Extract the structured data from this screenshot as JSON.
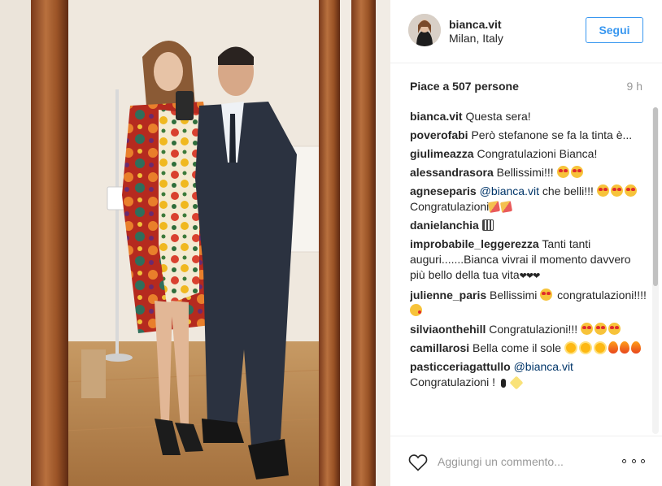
{
  "header": {
    "username": "bianca.vit",
    "location": "Milan, Italy",
    "follow_label": "Segui"
  },
  "likes": {
    "text": "Piace a 507 persone",
    "time": "9 h"
  },
  "comments": [
    {
      "user": "bianca.vit",
      "text": "Questa sera!"
    },
    {
      "user": "poverofabi",
      "text": "Però stefanone se fa la tinta è..."
    },
    {
      "user": "giulimeazza",
      "text": "Congratulazioni Bianca!"
    },
    {
      "user": "alessandrasora",
      "text": "Bellissimi!!!",
      "emoji": [
        "heart-eyes",
        "heart-eyes"
      ]
    },
    {
      "user": "agneseparis",
      "mention": "@bianca.vit",
      "text": "che belli!!!",
      "emoji": [
        "heart-eyes",
        "heart-eyes",
        "heart-eyes"
      ],
      "text2": "Congratulazioni",
      "emoji2": [
        "party",
        "party"
      ]
    },
    {
      "user": "danielanchia",
      "emoji": [
        "grid"
      ]
    },
    {
      "user": "improbabile_leggerezza",
      "text": "Tanti tanti auguri.......Bianca vivrai il momento davvero più bello della tua vita",
      "tail": "❤❤❤"
    },
    {
      "user": "julienne_paris",
      "text": "Bellissimi",
      "emoji": [
        "heart-eyes"
      ],
      "text2": "congratulazioni!!!!",
      "emoji2": [
        "kiss"
      ]
    },
    {
      "user": "silviaonthehill",
      "text": "Congratulazioni!!!",
      "emoji": [
        "heart-eyes",
        "heart-eyes",
        "heart-eyes"
      ]
    },
    {
      "user": "camillarosi",
      "text": "Bella come il sole",
      "emoji": [
        "sun",
        "sun",
        "sun",
        "fire",
        "fire",
        "fire"
      ]
    },
    {
      "user": "pasticceriagattullo",
      "mention": "@bianca.vit",
      "text": "Congratulazioni !",
      "emoji": [
        "ribbon",
        "sparkle"
      ]
    }
  ],
  "footer": {
    "comment_placeholder": "Aggiungi un commento..."
  },
  "colors": {
    "accent": "#3897f0",
    "text": "#262626",
    "muted": "#999999",
    "border": "#efefef"
  },
  "icons": {
    "like": "heart-outline-icon",
    "more": "more-options-icon"
  }
}
